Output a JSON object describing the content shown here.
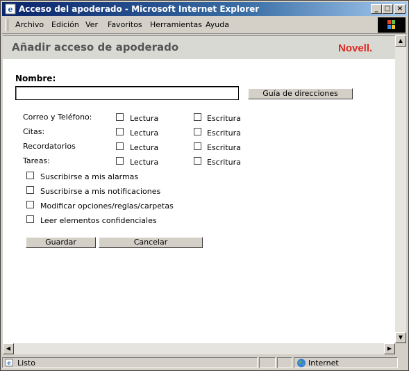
{
  "window": {
    "title": "Acceso del apoderado - Microsoft Internet Explorer"
  },
  "menu": [
    "Archivo",
    "Edición",
    "Ver",
    "Favoritos",
    "Herramientas",
    "Ayuda"
  ],
  "page": {
    "heading": "Añadir acceso de apoderado",
    "logo": "Novell.",
    "name_label": "Nombre:",
    "name_value": "",
    "address_book_button": "Guía de direcciones",
    "rows": [
      {
        "label": "Correo y Teléfono:",
        "read": "Lectura",
        "write": "Escritura"
      },
      {
        "label": "Citas:",
        "read": "Lectura",
        "write": "Escritura"
      },
      {
        "label": "Recordatorios",
        "read": "Lectura",
        "write": "Escritura"
      },
      {
        "label": "Tareas:",
        "read": "Lectura",
        "write": "Escritura"
      }
    ],
    "options": [
      "Suscribirse a mis alarmas",
      "Suscribirse a mis notificaciones",
      "Modificar opciones/reglas/carpetas",
      "Leer elementos confidenciales"
    ],
    "save_button": "Guardar",
    "cancel_button": "Cancelar"
  },
  "status": {
    "text": "Listo",
    "zone": "Internet"
  },
  "colors": {
    "title_bar": "#0a246a",
    "logo": "#e1261c",
    "header_band": "#d9d9d4"
  }
}
